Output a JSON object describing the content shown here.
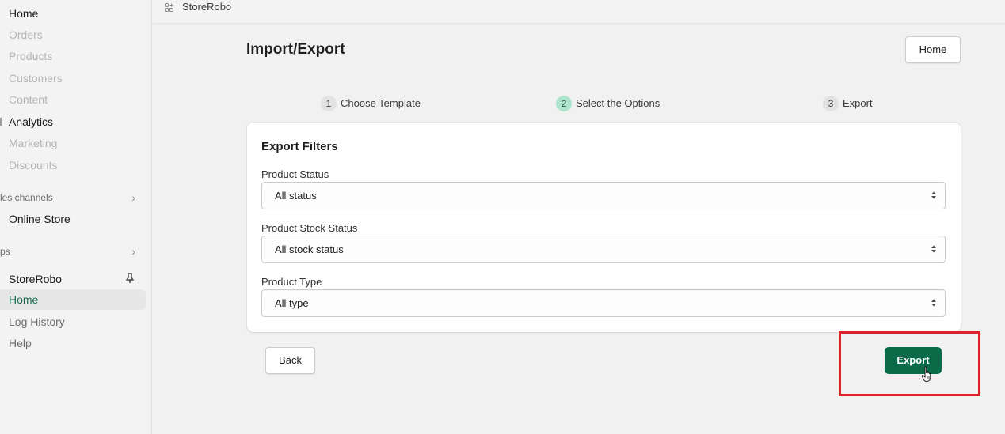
{
  "sidebar": {
    "items": [
      {
        "label": "Home",
        "style": "dark"
      },
      {
        "label": "Orders",
        "style": "muted"
      },
      {
        "label": "Products",
        "style": "muted"
      },
      {
        "label": "Customers",
        "style": "muted"
      },
      {
        "label": "Content",
        "style": "muted"
      },
      {
        "label": "Analytics",
        "style": "dark"
      },
      {
        "label": "Marketing",
        "style": "muted"
      },
      {
        "label": "Discounts",
        "style": "muted"
      }
    ],
    "sales_channels_label": "les channels",
    "online_store_label": "Online Store",
    "apps_label": "ps",
    "app_name": "StoreRobo",
    "app_subitems": [
      {
        "label": "Home",
        "active": true
      },
      {
        "label": "Log History",
        "active": false
      },
      {
        "label": "Help",
        "active": false
      }
    ]
  },
  "topbar": {
    "app_name": "StoreRobo",
    "app_icon": "apps-grid-icon"
  },
  "page": {
    "title": "Import/Export",
    "home_button": "Home"
  },
  "steps": [
    {
      "number": "1",
      "label": "Choose Template",
      "current": false
    },
    {
      "number": "2",
      "label": "Select the Options",
      "current": true
    },
    {
      "number": "3",
      "label": "Export",
      "current": false
    }
  ],
  "card": {
    "title": "Export Filters",
    "fields": [
      {
        "label": "Product Status",
        "value": "All status"
      },
      {
        "label": "Product Stock Status",
        "value": "All stock status"
      },
      {
        "label": "Product Type",
        "value": "All type"
      }
    ]
  },
  "actions": {
    "back": "Back",
    "export": "Export"
  },
  "colors": {
    "primary": "#0b6b48",
    "current_step": "#aee4cd",
    "highlight": "#e0202b"
  }
}
